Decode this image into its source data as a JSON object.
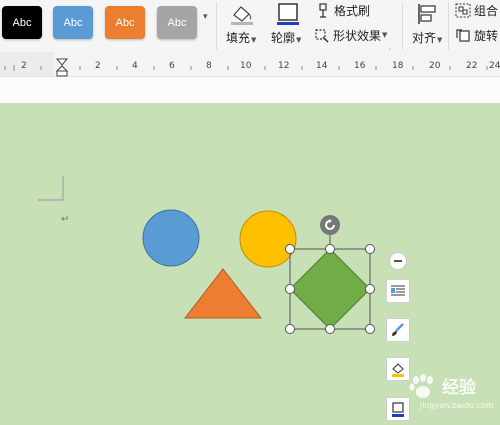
{
  "toolbar": {
    "style_buttons": [
      {
        "label": "Abc",
        "color": "#000000"
      },
      {
        "label": "Abc",
        "color": "#5b9bd5"
      },
      {
        "label": "Abc",
        "color": "#ed7d31"
      },
      {
        "label": "Abc",
        "color": "#a5a5a5"
      }
    ],
    "fill_label": "填充",
    "outline_label": "轮廓",
    "format_painter_label": "格式刷",
    "shape_effects_label": "形状效果",
    "align_label": "对齐",
    "group_label": "组合",
    "rotate_label": "旋转"
  },
  "ruler": {
    "numbers": [
      "2",
      "2",
      "4",
      "6",
      "8",
      "10",
      "12",
      "14",
      "16",
      "18",
      "20",
      "22",
      "24"
    ]
  },
  "canvas": {
    "background_color": "#c8e0b6",
    "shapes": [
      {
        "name": "circle",
        "color": "#5b9bd5"
      },
      {
        "name": "circle",
        "color": "#ffc000"
      },
      {
        "name": "triangle",
        "color": "#ed7d31"
      },
      {
        "name": "diamond",
        "color": "#70ad47",
        "selected": true
      }
    ]
  },
  "side_buttons": [
    "minus-icon",
    "layout-options-icon",
    "style-brush-icon",
    "shape-fill-icon",
    "shape-outline-icon"
  ],
  "watermark": {
    "text": "经验",
    "subtext": "jingyan.baidu.com"
  }
}
